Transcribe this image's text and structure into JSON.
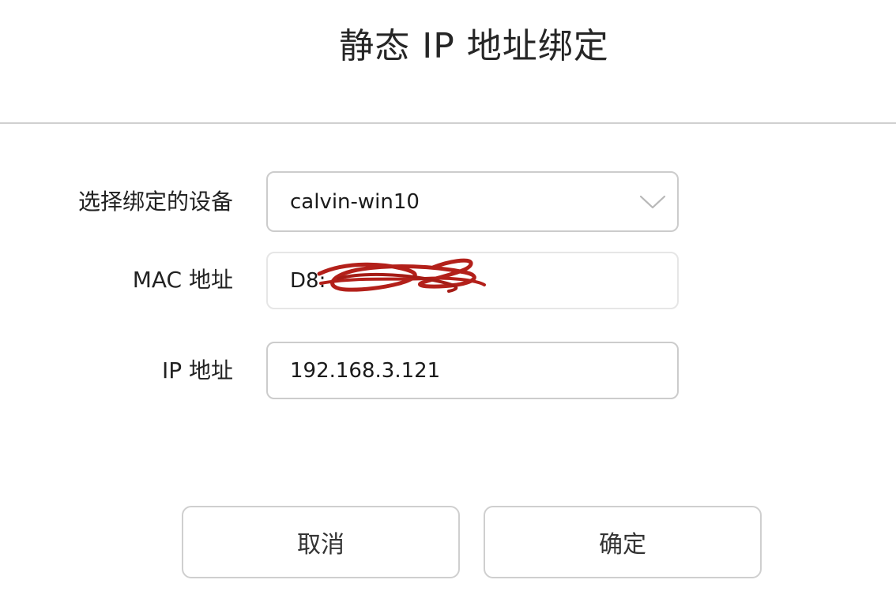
{
  "dialog": {
    "title": "静态 IP 地址绑定"
  },
  "form": {
    "device": {
      "label": "选择绑定的设备",
      "selected": "calvin-win10",
      "icon": "chevron-down-icon"
    },
    "mac": {
      "label": "MAC 地址",
      "value_visible_prefix": "D8:",
      "redaction_color": "#b3201a"
    },
    "ip": {
      "label": "IP 地址",
      "value": "192.168.3.121"
    }
  },
  "buttons": {
    "cancel": "取消",
    "confirm": "确定"
  }
}
